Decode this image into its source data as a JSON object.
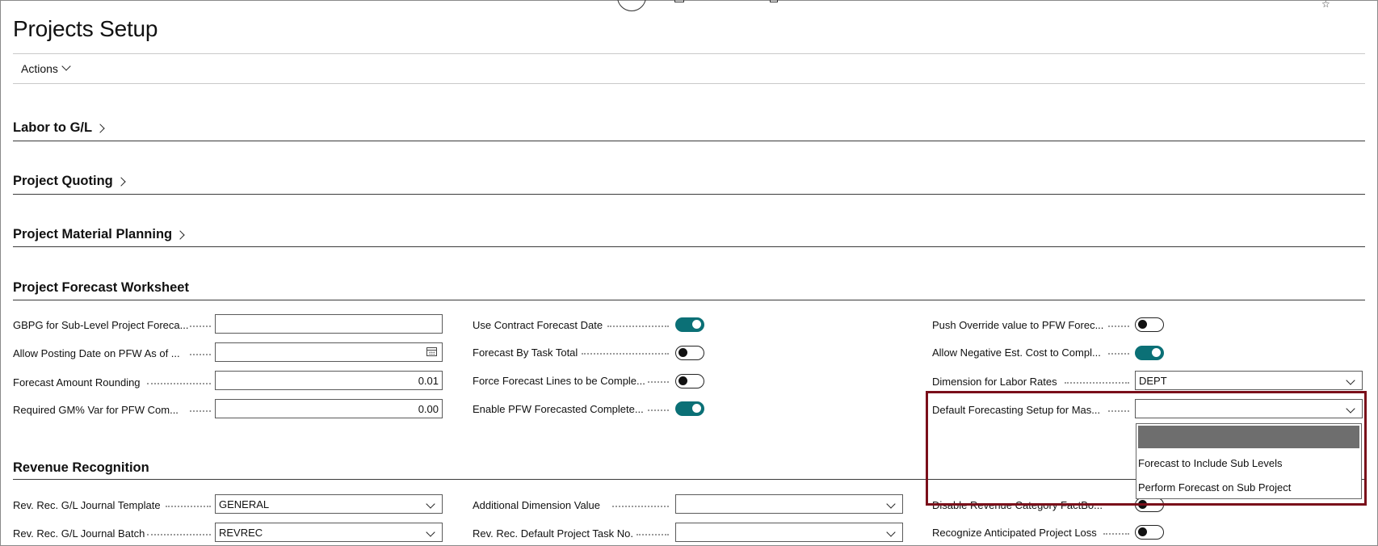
{
  "page": {
    "title": "Projects Setup",
    "actions_label": "Actions"
  },
  "sections": {
    "labor_to_gl": "Labor to G/L",
    "project_quoting": "Project Quoting",
    "project_material_planning": "Project Material Planning",
    "project_forecast_worksheet": "Project Forecast Worksheet",
    "revenue_recognition": "Revenue Recognition"
  },
  "pfw": {
    "col1": [
      {
        "label": "GBPG for Sub-Level Project Foreca...",
        "value": ""
      },
      {
        "label": "Allow Posting Date on PFW As of ...",
        "value": ""
      },
      {
        "label": "Forecast Amount Rounding",
        "value": "0.01"
      },
      {
        "label": "Required GM% Var for PFW Com...",
        "value": "0.00"
      }
    ],
    "col2": [
      {
        "label": "Use Contract Forecast Date",
        "on": true
      },
      {
        "label": "Forecast By Task Total",
        "on": false
      },
      {
        "label": "Force Forecast Lines to be Comple...",
        "on": false
      },
      {
        "label": "Enable PFW Forecasted Complete...",
        "on": true
      }
    ],
    "col3": {
      "push_override": {
        "label": "Push Override value to PFW Forec...",
        "on": false
      },
      "allow_negative": {
        "label": "Allow Negative Est. Cost to Compl...",
        "on": true
      },
      "dimension_labor": {
        "label": "Dimension for Labor Rates",
        "value": "DEPT"
      },
      "default_forecasting": {
        "label": "Default Forecasting Setup for Mas...",
        "value": ""
      }
    }
  },
  "dropdown": {
    "options": [
      "",
      "Forecast to Include Sub Levels",
      "Perform Forecast on Sub Project"
    ]
  },
  "revrec": {
    "col1": [
      {
        "label": "Rev. Rec. G/L Journal Template",
        "value": "GENERAL"
      },
      {
        "label": "Rev. Rec. G/L Journal Batch",
        "value": "REVREC"
      }
    ],
    "col2": [
      {
        "label": "Additional Dimension Value",
        "value": ""
      },
      {
        "label": "Rev. Rec. Default Project Task No.",
        "value": ""
      }
    ],
    "col3": [
      {
        "label": "Disable Revenue Category FactBo...",
        "on": false
      },
      {
        "label": "Recognize Anticipated Project Loss",
        "on": false
      }
    ]
  },
  "colors": {
    "toggle_on": "#0b7076",
    "highlight_border": "#7a0f1a"
  }
}
